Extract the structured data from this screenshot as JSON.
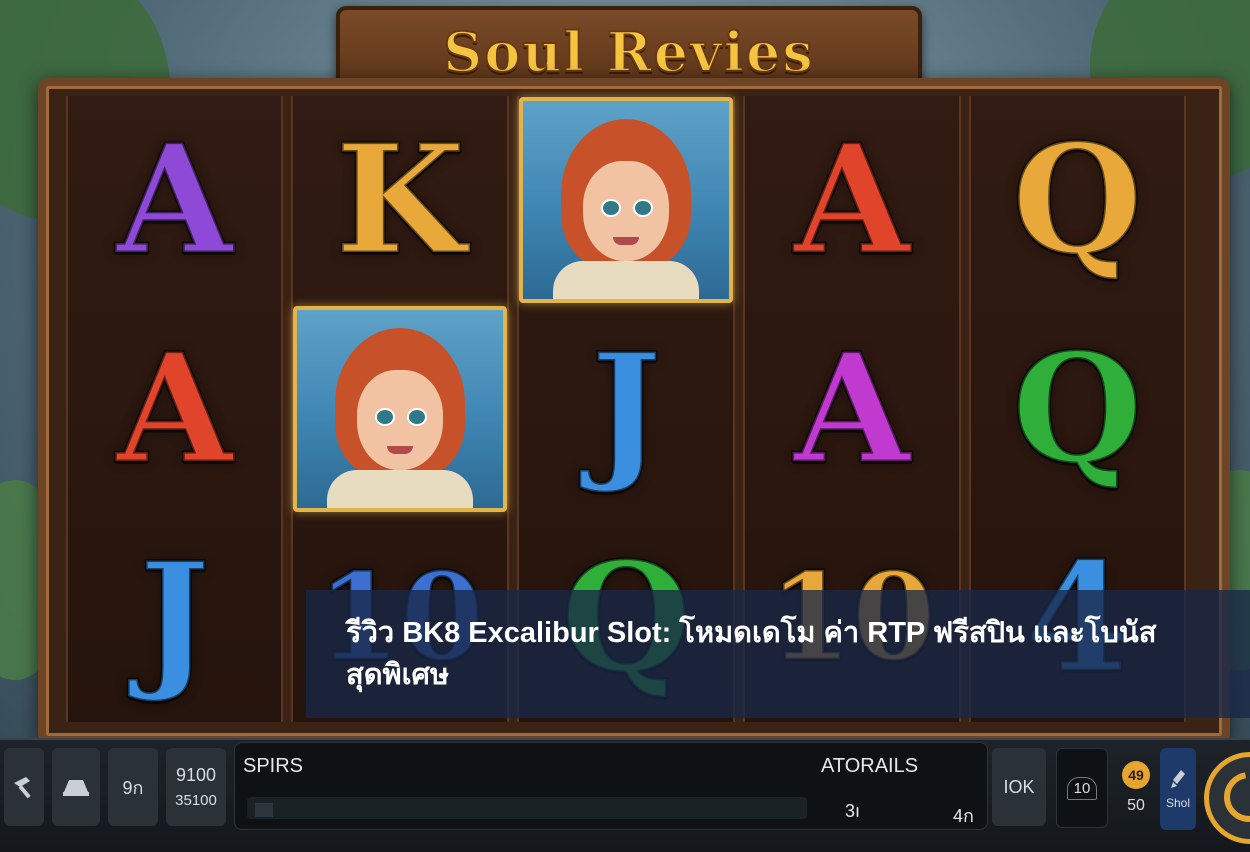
{
  "game": {
    "title": "Soul Revies"
  },
  "reels": [
    [
      {
        "type": "letter",
        "value": "A",
        "color": "#8e4ad6"
      },
      {
        "type": "letter",
        "value": "A",
        "color": "#e0452c"
      },
      {
        "type": "letter",
        "value": "J",
        "color": "#3b8fe0"
      }
    ],
    [
      {
        "type": "letter",
        "value": "K",
        "color": "#e8a93a"
      },
      {
        "type": "portrait",
        "value": "girl-portrait"
      },
      {
        "type": "letter",
        "value": "10",
        "color": "#3b6fd0"
      }
    ],
    [
      {
        "type": "portrait",
        "value": "girl-portrait"
      },
      {
        "type": "letter",
        "value": "J",
        "color": "#3b8fe0"
      },
      {
        "type": "letter",
        "value": "Q",
        "color": "#2fae3a"
      }
    ],
    [
      {
        "type": "letter",
        "value": "A",
        "color": "#e0452c"
      },
      {
        "type": "letter",
        "value": "A",
        "color": "#c03ad0"
      },
      {
        "type": "letter",
        "value": "10",
        "color": "#e8a93a"
      }
    ],
    [
      {
        "type": "letter",
        "value": "Q",
        "color": "#e8a93a"
      },
      {
        "type": "letter",
        "value": "Q",
        "color": "#2fae3a"
      },
      {
        "type": "letter",
        "value": "4",
        "color": "#3b8fe0"
      }
    ]
  ],
  "overlay": {
    "headline": "รีวิว BK8 Excalibur Slot: โหมดเดโม ค่า RTP ฟรีสปิน และโบนัสสุดพิเศษ"
  },
  "controls": {
    "left_labels": [
      "9ก",
      "9100",
      "35100"
    ],
    "panel_left_label": "SPIRS",
    "panel_right_label": "ATORAILS",
    "panel_value_1": "3ı",
    "panel_value_2": "4ก",
    "progress": 0.0,
    "right_labels": [
      "IOK",
      "10",
      "49",
      "50",
      "Shol"
    ]
  },
  "icons": [
    "hammer-icon",
    "hat-icon",
    "info-icon",
    "coin-icon",
    "brush-icon",
    "spin-icon"
  ]
}
